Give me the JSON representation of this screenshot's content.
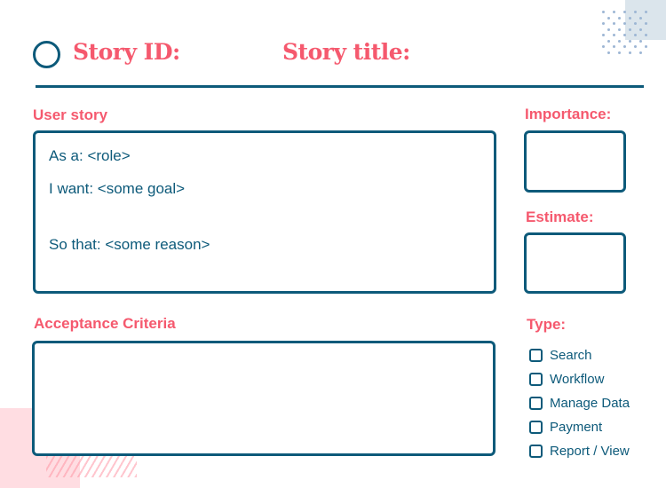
{
  "header": {
    "story_id_label": "Story ID:",
    "story_title_label": "Story title:"
  },
  "user_story": {
    "label": "User story",
    "lines": {
      "role": "As a: <role>",
      "goal": "I want: <some goal>",
      "reason": "So that: <some reason>"
    }
  },
  "importance": {
    "label": "Importance:",
    "value": ""
  },
  "estimate": {
    "label": "Estimate:",
    "value": ""
  },
  "acceptance_criteria": {
    "label": "Acceptance Criteria",
    "value": ""
  },
  "type": {
    "label": "Type:",
    "options": [
      {
        "label": "Search",
        "checked": false
      },
      {
        "label": "Workflow",
        "checked": false
      },
      {
        "label": "Manage Data",
        "checked": false
      },
      {
        "label": "Payment",
        "checked": false
      },
      {
        "label": "Report / View",
        "checked": false
      }
    ]
  },
  "colors": {
    "accent_pink": "#f5596e",
    "primary_navy": "#0d5a7a",
    "deco_pink": "#ffdde2",
    "deco_blue": "#dbe5ec"
  }
}
